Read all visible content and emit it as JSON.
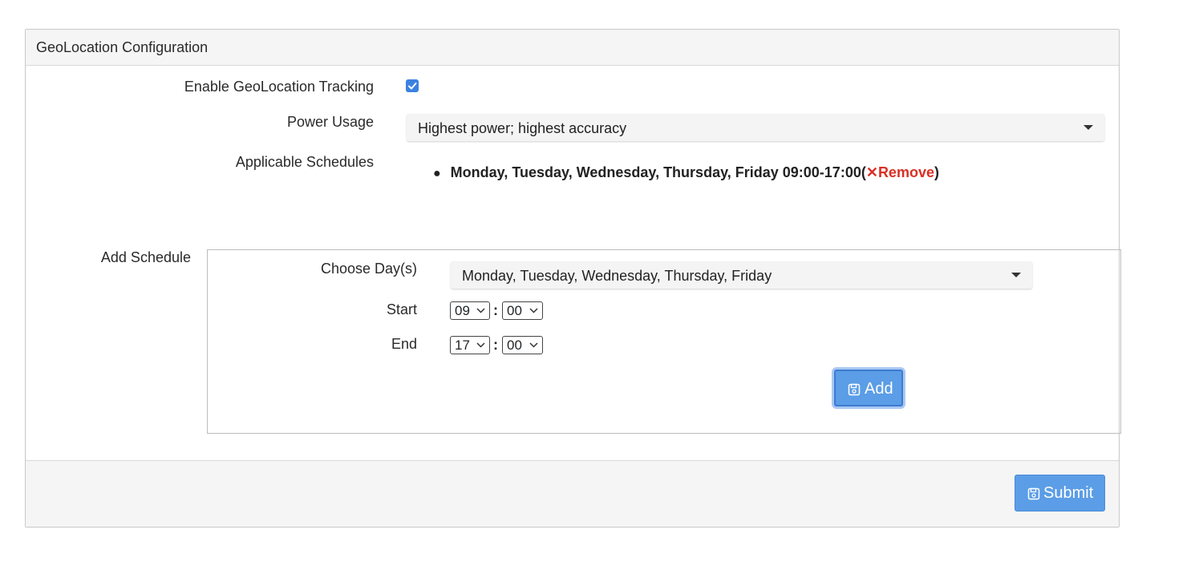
{
  "panel": {
    "title": "GeoLocation Configuration"
  },
  "form": {
    "enable_tracking_label": "Enable GeoLocation Tracking",
    "enable_tracking_checked": true,
    "power_usage_label": "Power Usage",
    "power_usage_value": "Highest power; highest accuracy",
    "applicable_schedules_label": "Applicable Schedules",
    "schedules": [
      {
        "text": "Monday, Tuesday, Wednesday, Thursday, Friday 09:00-17:00",
        "remove_open": "(",
        "remove_icon": "✕",
        "remove_label": "Remove",
        "remove_close": ")"
      }
    ]
  },
  "add_schedule": {
    "label": "Add Schedule",
    "choose_days_label": "Choose Day(s)",
    "days_value": "Monday, Tuesday, Wednesday, Thursday, Friday",
    "start_label": "Start",
    "start_hour": "09",
    "start_minute": "00",
    "end_label": "End",
    "end_hour": "17",
    "end_minute": "00",
    "separator": ":",
    "add_button_label": "Add"
  },
  "footer": {
    "submit_label": "Submit"
  },
  "colors": {
    "accent": "#5b9de6",
    "remove": "#d93025",
    "checkbox": "#3b82e0"
  },
  "icons": {
    "add_button_icon": "floppy-disk-icon",
    "submit_button_icon": "floppy-disk-icon",
    "remove_icon": "close-icon"
  }
}
